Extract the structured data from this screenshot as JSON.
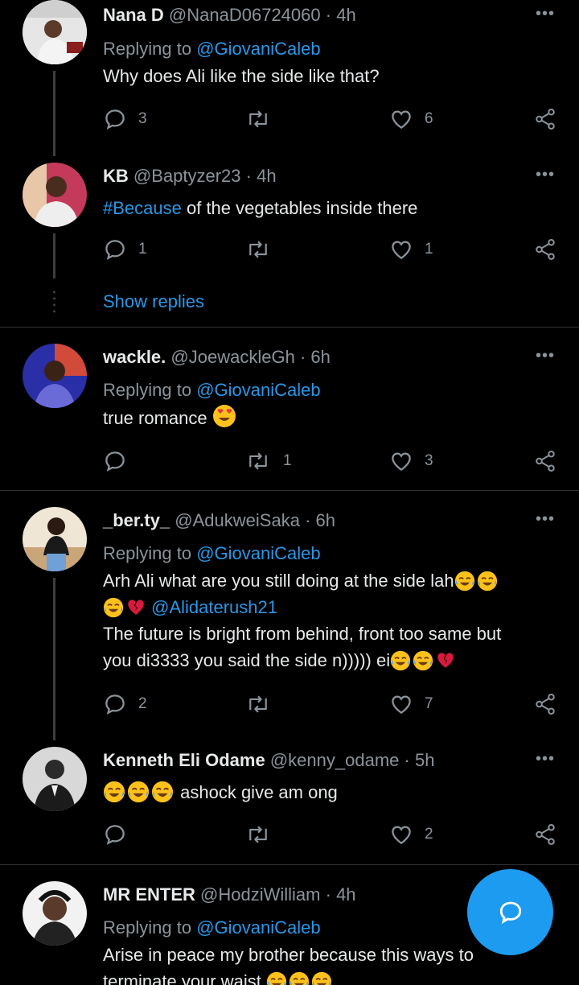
{
  "tweets": [
    {
      "name": "Nana D",
      "handle": "@NanaD06724060",
      "time": "4h",
      "replying_label": "Replying to",
      "replying_to": "@GiovaniCaleb",
      "text": "Why does Ali like the side like that?",
      "replies": "3",
      "retweets": "",
      "likes": "6"
    },
    {
      "name": "KB",
      "handle": "@Baptyzer23",
      "time": "4h",
      "hashtag": "#Because",
      "text": "of the vegetables inside there",
      "replies": "1",
      "retweets": "",
      "likes": "1"
    },
    {
      "name": "wackle.",
      "handle": "@JoewackleGh",
      "time": "6h",
      "replying_label": "Replying to",
      "replying_to": "@GiovaniCaleb",
      "text": "true romance",
      "replies": "",
      "retweets": "1",
      "likes": "3"
    },
    {
      "name": "_ber.ty_",
      "handle": "@AdukweiSaka",
      "time": "6h",
      "replying_label": "Replying to",
      "replying_to": "@GiovaniCaleb",
      "text_line1": "Arh Ali what are you still doing at the side lah",
      "mention": "@Alidaterush21",
      "text_line3": "The future is bright from behind, front too same but",
      "text_line4": "you di3333 you said the side n))))) ei",
      "replies": "2",
      "retweets": "",
      "likes": "7"
    },
    {
      "name": "Kenneth Eli Odame",
      "handle": "@kenny_odame",
      "time": "5h",
      "text": "ashock give am ong",
      "replies": "",
      "retweets": "",
      "likes": "2"
    },
    {
      "name": "MR ENTER",
      "handle": "@HodziWilliam",
      "time": "4h",
      "replying_label": "Replying to",
      "replying_to": "@GiovaniCaleb",
      "text": "Arise in peace my brother because this ways to",
      "text_cut": "terminate your waist"
    }
  ],
  "show_replies": "Show replies",
  "more_glyph": "•••",
  "colors": {
    "accent": "#1d9bf0",
    "link": "#2a97e6",
    "muted": "#8b949b",
    "background": "#000000"
  }
}
